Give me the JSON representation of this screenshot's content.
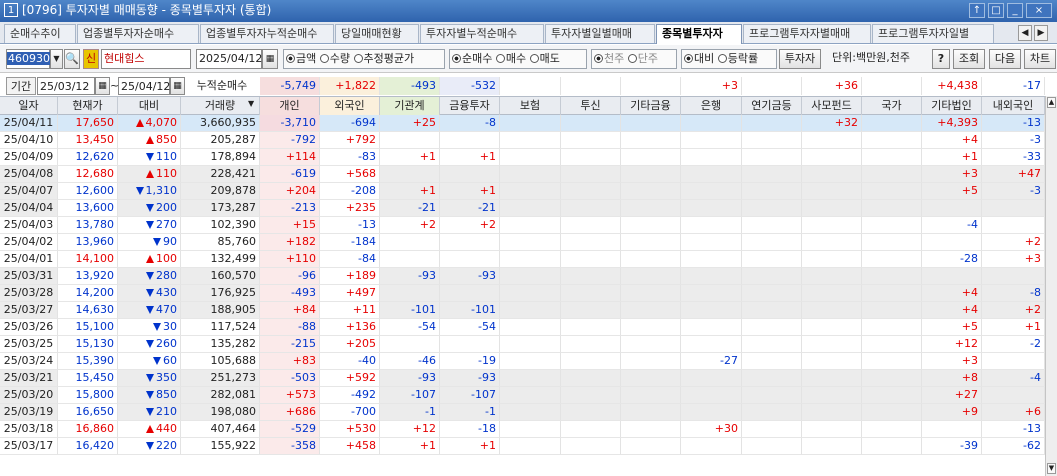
{
  "window": {
    "number": "1",
    "title": "[0796] 투자자별 매매동향 - 종목별투자자 (통합)",
    "buttons": [
      "↑",
      "□",
      "_",
      "×"
    ]
  },
  "tabs": [
    {
      "label": "순매수추이",
      "active": false
    },
    {
      "label": "업종별투자자순매수",
      "active": false
    },
    {
      "label": "업종별투자자누적순매수",
      "active": false
    },
    {
      "label": "당일매매현황",
      "active": false
    },
    {
      "label": "투자자별누적순매수",
      "active": false
    },
    {
      "label": "투자자별일별매매",
      "active": false
    },
    {
      "label": "종목별투자자",
      "active": true
    },
    {
      "label": "프로그램투자자별매매",
      "active": false
    },
    {
      "label": "프로그램투자자일별",
      "active": false
    }
  ],
  "toolbar": {
    "stock_code": "460930",
    "credit_badge": "신",
    "stock_name": "현대힘스",
    "date": "2025/04/12",
    "amount_group": [
      "금액",
      "수량",
      "추정평균가"
    ],
    "amount_selected": 0,
    "trade_group": [
      "순매수",
      "매수",
      "매도"
    ],
    "trade_selected": 0,
    "unit_group": [
      "천주",
      "단주"
    ],
    "unit_selected": 0,
    "compare_group": [
      "대비",
      "등락률"
    ],
    "compare_selected": 0,
    "investor_button": "투자자",
    "unit_label": "단위:백만원,천주",
    "help_button": "?",
    "search_button": "조회",
    "next_button": "다음",
    "chart_button": "차트"
  },
  "period": {
    "label": "기간",
    "from": "25/03/12",
    "to": "25/04/12",
    "sum_label": "누적순매수",
    "sums": [
      "-5,749",
      "+1,822",
      "-493",
      "-532",
      "",
      "",
      "",
      "+3",
      "",
      "+36",
      "",
      "+4,438",
      "-17"
    ]
  },
  "columns": [
    "일자",
    "현재가",
    "대비",
    "거래량",
    "개인",
    "외국인",
    "기관계",
    "금융투자",
    "보험",
    "투신",
    "기타금융",
    "은행",
    "연기금등",
    "사모펀드",
    "국가",
    "기타법인",
    "내외국인"
  ],
  "rows": [
    {
      "d": "25/04/11",
      "p": "17,650",
      "dir": "up",
      "chg": "4,070",
      "vol": "3,660,935",
      "v": [
        "-3,710",
        "-694",
        "+25",
        "-8",
        "",
        "",
        "",
        "",
        "",
        "+32",
        "",
        "+4,393",
        "-13"
      ]
    },
    {
      "d": "25/04/10",
      "p": "13,450",
      "dir": "up",
      "chg": "850",
      "vol": "205,287",
      "v": [
        "-792",
        "+792",
        "",
        "",
        "",
        "",
        "",
        "",
        "",
        "",
        "",
        "+4",
        "-3"
      ]
    },
    {
      "d": "25/04/09",
      "p": "12,620",
      "dir": "dn",
      "chg": "110",
      "vol": "178,894",
      "v": [
        "+114",
        "-83",
        "+1",
        "+1",
        "",
        "",
        "",
        "",
        "",
        "",
        "",
        "+1",
        "-33"
      ]
    },
    {
      "d": "25/04/08",
      "p": "12,680",
      "dir": "up",
      "chg": "110",
      "vol": "228,421",
      "v": [
        "-619",
        "+568",
        "",
        "",
        "",
        "",
        "",
        "",
        "",
        "",
        "",
        "+3",
        "+47"
      ]
    },
    {
      "d": "25/04/07",
      "p": "12,600",
      "dir": "dn",
      "chg": "1,310",
      "vol": "209,878",
      "v": [
        "+204",
        "-208",
        "+1",
        "+1",
        "",
        "",
        "",
        "",
        "",
        "",
        "",
        "+5",
        "-3"
      ]
    },
    {
      "d": "25/04/04",
      "p": "13,600",
      "dir": "dn",
      "chg": "200",
      "vol": "173,287",
      "v": [
        "-213",
        "+235",
        "-21",
        "-21",
        "",
        "",
        "",
        "",
        "",
        "",
        "",
        "",
        ""
      ]
    },
    {
      "d": "25/04/03",
      "p": "13,780",
      "dir": "dn",
      "chg": "270",
      "vol": "102,390",
      "v": [
        "+15",
        "-13",
        "+2",
        "+2",
        "",
        "",
        "",
        "",
        "",
        "",
        "",
        "-4",
        ""
      ]
    },
    {
      "d": "25/04/02",
      "p": "13,960",
      "dir": "dn",
      "chg": "90",
      "vol": "85,760",
      "v": [
        "+182",
        "-184",
        "",
        "",
        "",
        "",
        "",
        "",
        "",
        "",
        "",
        "",
        "+2"
      ]
    },
    {
      "d": "25/04/01",
      "p": "14,100",
      "dir": "up",
      "chg": "100",
      "vol": "132,499",
      "v": [
        "+110",
        "-84",
        "",
        "",
        "",
        "",
        "",
        "",
        "",
        "",
        "",
        "-28",
        "+3"
      ]
    },
    {
      "d": "25/03/31",
      "p": "13,920",
      "dir": "dn",
      "chg": "280",
      "vol": "160,570",
      "v": [
        "-96",
        "+189",
        "-93",
        "-93",
        "",
        "",
        "",
        "",
        "",
        "",
        "",
        "",
        ""
      ]
    },
    {
      "d": "25/03/28",
      "p": "14,200",
      "dir": "dn",
      "chg": "430",
      "vol": "176,925",
      "v": [
        "-493",
        "+497",
        "",
        "",
        "",
        "",
        "",
        "",
        "",
        "",
        "",
        "+4",
        "-8"
      ]
    },
    {
      "d": "25/03/27",
      "p": "14,630",
      "dir": "dn",
      "chg": "470",
      "vol": "188,905",
      "v": [
        "+84",
        "+11",
        "-101",
        "-101",
        "",
        "",
        "",
        "",
        "",
        "",
        "",
        "+4",
        "+2"
      ]
    },
    {
      "d": "25/03/26",
      "p": "15,100",
      "dir": "dn",
      "chg": "30",
      "vol": "117,524",
      "v": [
        "-88",
        "+136",
        "-54",
        "-54",
        "",
        "",
        "",
        "",
        "",
        "",
        "",
        "+5",
        "+1"
      ]
    },
    {
      "d": "25/03/25",
      "p": "15,130",
      "dir": "dn",
      "chg": "260",
      "vol": "135,282",
      "v": [
        "-215",
        "+205",
        "",
        "",
        "",
        "",
        "",
        "",
        "",
        "",
        "",
        "+12",
        "-2"
      ]
    },
    {
      "d": "25/03/24",
      "p": "15,390",
      "dir": "dn",
      "chg": "60",
      "vol": "105,688",
      "v": [
        "+83",
        "-40",
        "-46",
        "-19",
        "",
        "",
        "",
        "-27",
        "",
        "",
        "",
        "+3",
        ""
      ]
    },
    {
      "d": "25/03/21",
      "p": "15,450",
      "dir": "dn",
      "chg": "350",
      "vol": "251,273",
      "v": [
        "-503",
        "+592",
        "-93",
        "-93",
        "",
        "",
        "",
        "",
        "",
        "",
        "",
        "+8",
        "-4"
      ]
    },
    {
      "d": "25/03/20",
      "p": "15,800",
      "dir": "dn",
      "chg": "850",
      "vol": "282,081",
      "v": [
        "+573",
        "-492",
        "-107",
        "-107",
        "",
        "",
        "",
        "",
        "",
        "",
        "",
        "+27",
        ""
      ]
    },
    {
      "d": "25/03/19",
      "p": "16,650",
      "dir": "dn",
      "chg": "210",
      "vol": "198,080",
      "v": [
        "+686",
        "-700",
        "-1",
        "-1",
        "",
        "",
        "",
        "",
        "",
        "",
        "",
        "+9",
        "+6"
      ]
    },
    {
      "d": "25/03/18",
      "p": "16,860",
      "dir": "up",
      "chg": "440",
      "vol": "407,464",
      "v": [
        "-529",
        "+530",
        "+12",
        "-18",
        "",
        "",
        "",
        "+30",
        "",
        "",
        "",
        "",
        "-13"
      ]
    },
    {
      "d": "25/03/17",
      "p": "16,420",
      "dir": "dn",
      "chg": "220",
      "vol": "155,922",
      "v": [
        "-358",
        "+458",
        "+1",
        "+1",
        "",
        "",
        "",
        "",
        "",
        "",
        "",
        "-39",
        "-62"
      ]
    }
  ],
  "colors": {
    "up": "#e60000",
    "down": "#0033cc",
    "title": "#3a6fb8",
    "selected": "#d6e8f8"
  }
}
